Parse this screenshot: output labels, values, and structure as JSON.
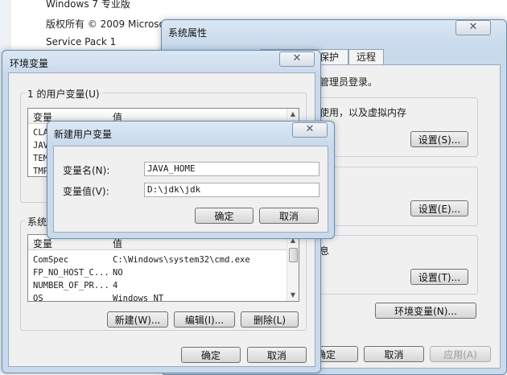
{
  "background": {
    "edition": "Windows 7 专业版",
    "copyright": "版权所有 © 2009 Microso",
    "service_pack": "Service Pack 1"
  },
  "system_properties": {
    "title": "系统属性",
    "tabs": [
      "",
      "统保护",
      "远程"
    ],
    "admin_note": "管理员登录。",
    "performance_note": "使用，以及虚拟内存",
    "profiles_note": "息",
    "settings_s": "设置(S)...",
    "settings_e": "设置(E)...",
    "settings_t": "设置(T)...",
    "env_vars_button": "环境变量(N)...",
    "ok": "确定",
    "cancel": "取消",
    "apply": "应用(A)"
  },
  "env_vars": {
    "title": "环境变量",
    "user_group_label": "1 的用户变量(U)",
    "system_group_label": "系统",
    "columns": [
      "变量",
      "值"
    ],
    "user_rows": [
      {
        "name": "CLA",
        "value": ""
      },
      {
        "name": "JAV",
        "value": ""
      },
      {
        "name": "TEM",
        "value": ""
      },
      {
        "name": "TMP",
        "value": ""
      }
    ],
    "system_rows": [
      {
        "name": "ComSpec",
        "value": "C:\\Windows\\system32\\cmd.exe"
      },
      {
        "name": "FP_NO_HOST_C...",
        "value": "NO"
      },
      {
        "name": "NUMBER_OF_PR...",
        "value": "4"
      },
      {
        "name": "OS",
        "value": "Windows_NT"
      }
    ],
    "new_button": "新建(W)...",
    "edit_button": "编辑(I)...",
    "delete_button": "删除(L)",
    "ok": "确定",
    "cancel": "取消"
  },
  "new_var_dialog": {
    "title": "新建用户变量",
    "name_label": "变量名(N):",
    "name_value": "JAVA_HOME",
    "value_label": "变量值(V):",
    "value_value": "D:\\jdk\\jdk",
    "ok": "确定",
    "cancel": "取消"
  },
  "colors": {
    "titlebar": "#c9daec",
    "client": "#f0f0f0",
    "border": "#6e8aa8"
  }
}
